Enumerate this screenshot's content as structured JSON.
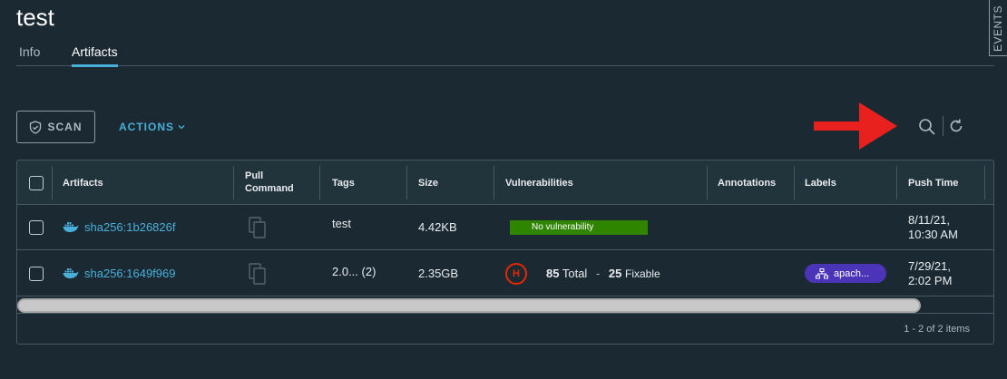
{
  "page": {
    "title": "test"
  },
  "tabs": [
    {
      "label": "Info"
    },
    {
      "label": "Artifacts",
      "active": true
    }
  ],
  "side_panel": {
    "label": "EVENTS"
  },
  "toolbar": {
    "scan_label": "SCAN",
    "actions_label": "ACTIONS"
  },
  "icons": {
    "shield": "shield-icon",
    "chevron": "chevron-down-icon",
    "search": "search-icon",
    "refresh": "refresh-icon",
    "docker": "docker-icon",
    "copy": "copy-icon",
    "label": "tag-hierarchy-icon"
  },
  "colors": {
    "accent": "#49afd9",
    "ok": "#2f8400",
    "high": "#e62700",
    "label": "#4b34b8",
    "annotation_arrow": "#e8201e"
  },
  "table": {
    "columns": [
      "Artifacts",
      "Pull Command",
      "Tags",
      "Size",
      "Vulnerabilities",
      "Annotations",
      "Labels",
      "Push Time"
    ],
    "rows": [
      {
        "artifact": "sha256:1b26826f",
        "tags": "test",
        "size": "4.42KB",
        "vulnerabilities": "No vulnerability",
        "annotations": "",
        "label": "",
        "push_time_date": "8/11/21,",
        "push_time_time": "10:30 AM"
      },
      {
        "artifact": "sha256:1649f969",
        "tags": "2.0... (2)",
        "size": "2.35GB",
        "severity": "H",
        "total_count": "85",
        "total_label": "Total",
        "separator": "-",
        "fixable_count": "25",
        "fixable_label": "Fixable",
        "annotations": "",
        "label": "apach...",
        "push_time_date": "7/29/21,",
        "push_time_time": "2:02 PM"
      }
    ]
  },
  "pagination": {
    "summary": "1 - 2 of 2 items"
  }
}
